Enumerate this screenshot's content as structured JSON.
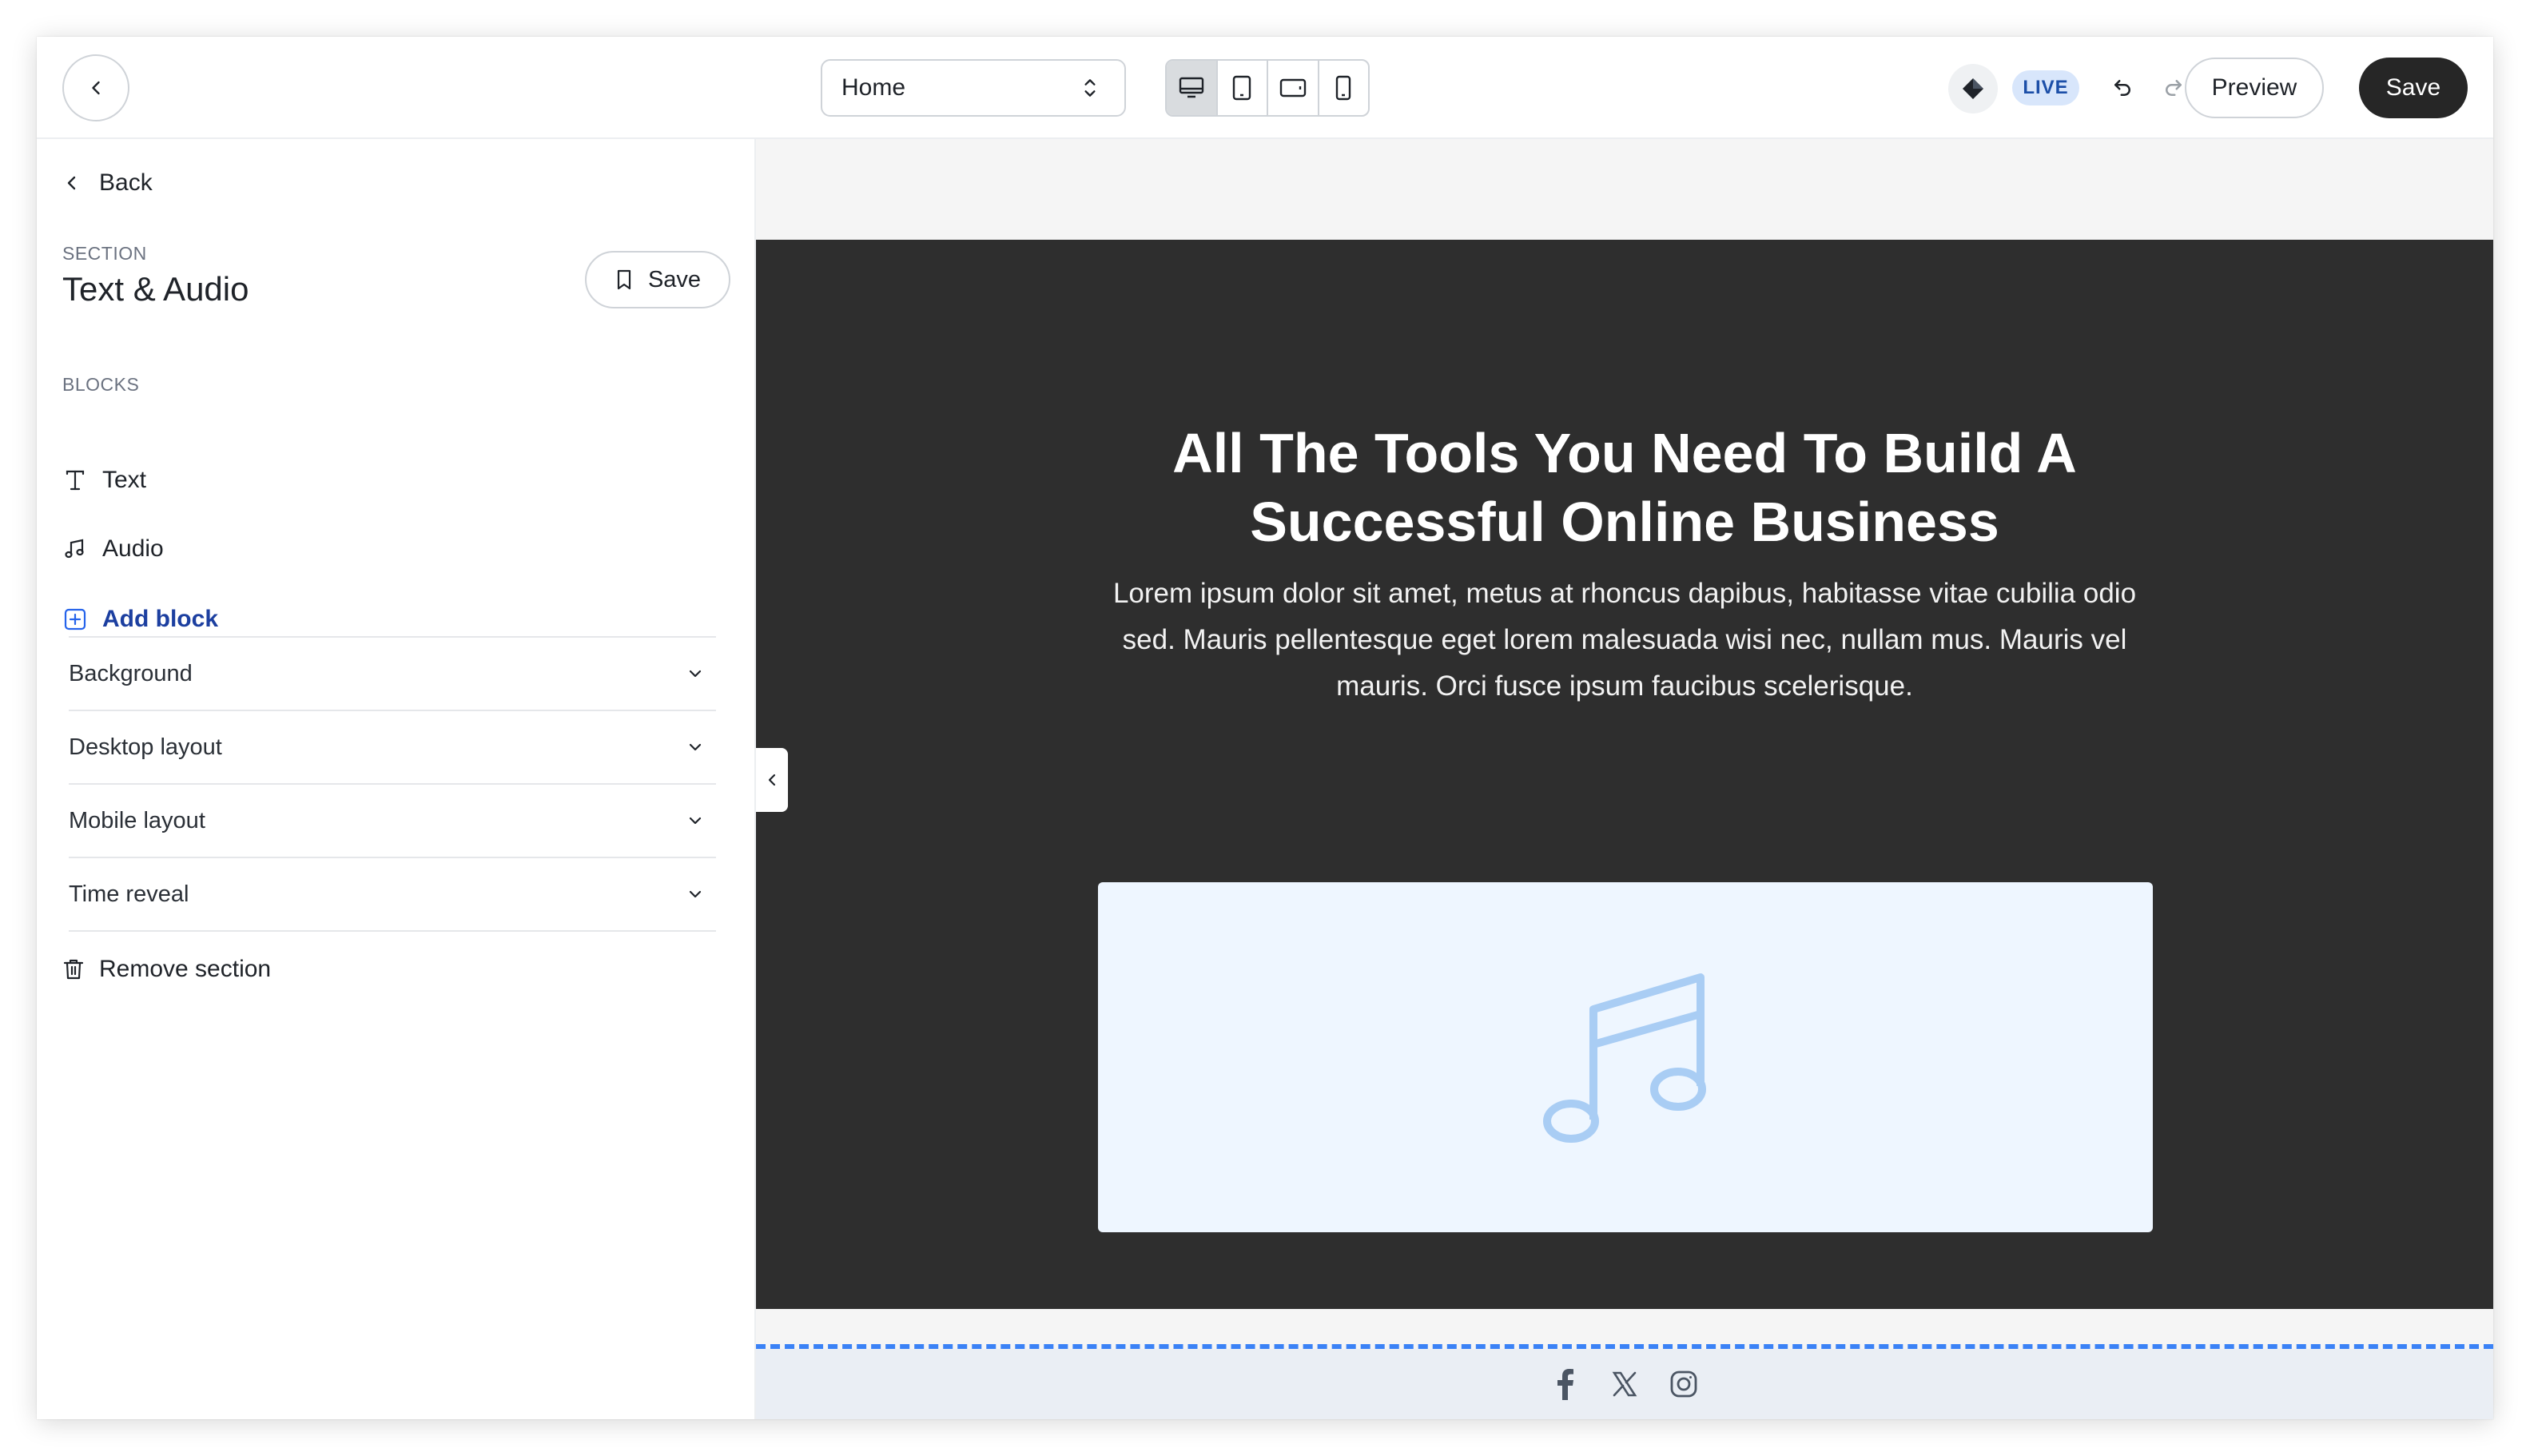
{
  "topbar": {
    "page_select_value": "Home",
    "live_badge": "LIVE",
    "preview_label": "Preview",
    "save_label": "Save"
  },
  "sidebar": {
    "back_label": "Back",
    "section_label": "SECTION",
    "section_title": "Text & Audio",
    "section_save_label": "Save",
    "blocks_label": "BLOCKS",
    "blocks": [
      {
        "label": "Text",
        "icon": "text-icon"
      },
      {
        "label": "Audio",
        "icon": "music-note-icon"
      }
    ],
    "add_block_label": "Add block",
    "accordions": [
      {
        "label": "Background"
      },
      {
        "label": "Desktop layout"
      },
      {
        "label": "Mobile layout"
      },
      {
        "label": "Time reveal"
      }
    ],
    "remove_label": "Remove section"
  },
  "canvas": {
    "hero_title": "All The Tools You Need To Build A Successful Online Business",
    "hero_body": "Lorem ipsum dolor sit amet, metus at rhoncus dapibus, habitasse vitae cubilia odio sed. Mauris pellentesque eget lorem malesuada wisi nec, nullam mus. Mauris vel mauris. Orci fusce ipsum faucibus scelerisque.",
    "footer_icons": [
      "facebook-icon",
      "x-icon",
      "instagram-icon"
    ]
  },
  "colors": {
    "accent": "#3b82f6",
    "dark_section": "#2e2e2e",
    "audio_placeholder_bg": "#eef6ff",
    "live_badge_bg": "#d8e6fb",
    "add_block_text": "#1c3fa0"
  }
}
